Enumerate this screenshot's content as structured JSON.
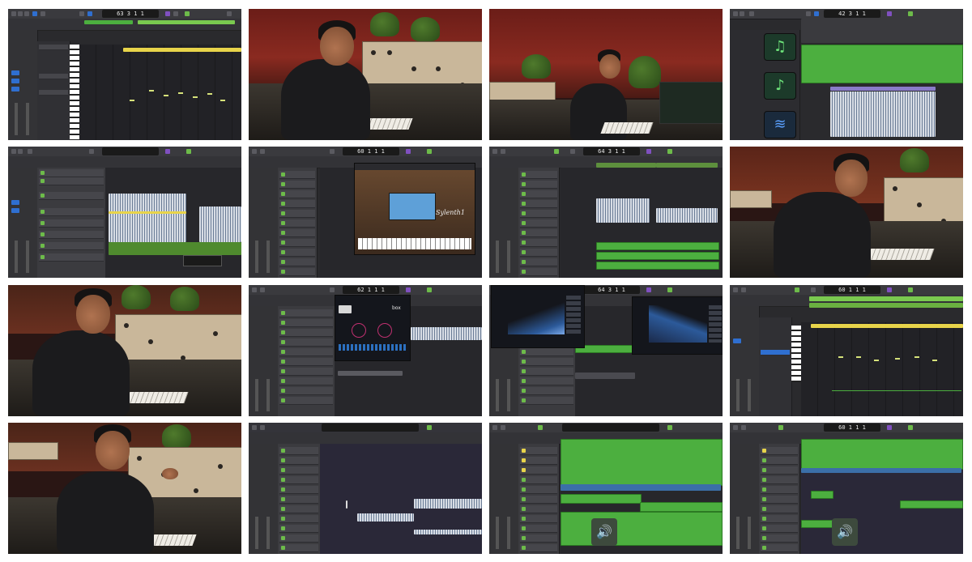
{
  "grid": {
    "tiles": [
      {
        "kind": "daw",
        "view": "piano-roll",
        "lcd": "63 3 1 1"
      },
      {
        "kind": "photo",
        "view": "producer-at-console"
      },
      {
        "kind": "photo",
        "view": "producer-wide-shot"
      },
      {
        "kind": "daw",
        "view": "audio-conversion",
        "lcd": "42 3 1 1"
      },
      {
        "kind": "daw",
        "view": "arrangement-drums",
        "lcd": ""
      },
      {
        "kind": "daw",
        "view": "synth-plugin",
        "lcd": "60 1 1 1",
        "plugin_label": "Sylenth1"
      },
      {
        "kind": "daw",
        "view": "arrangement",
        "lcd": "64 3 1 1"
      },
      {
        "kind": "photo",
        "view": "producer-close-up"
      },
      {
        "kind": "photo",
        "view": "producer-seated"
      },
      {
        "kind": "daw",
        "view": "drum-plugin",
        "lcd": "62 1 1 1",
        "plugin_label": "box"
      },
      {
        "kind": "daw",
        "view": "eq-plugins",
        "lcd": "64 3 1 1"
      },
      {
        "kind": "daw",
        "view": "piano-roll",
        "lcd": "60 1 1 1"
      },
      {
        "kind": "photo",
        "view": "producer-explaining"
      },
      {
        "kind": "daw",
        "view": "automation",
        "lcd": ""
      },
      {
        "kind": "daw",
        "view": "full-arrangement",
        "lcd": ""
      },
      {
        "kind": "daw",
        "view": "full-arrangement-2",
        "lcd": "60 1 1 1"
      }
    ]
  },
  "colors": {
    "region_green": "#4caf3f",
    "region_blue": "#3b6fa8",
    "lcd_bg": "#1a1a1a",
    "wall_red": "#8a2a20"
  },
  "icons": {
    "note": "music-note-icon",
    "speaker": "speaker-icon",
    "waveform": "waveform-icon"
  }
}
